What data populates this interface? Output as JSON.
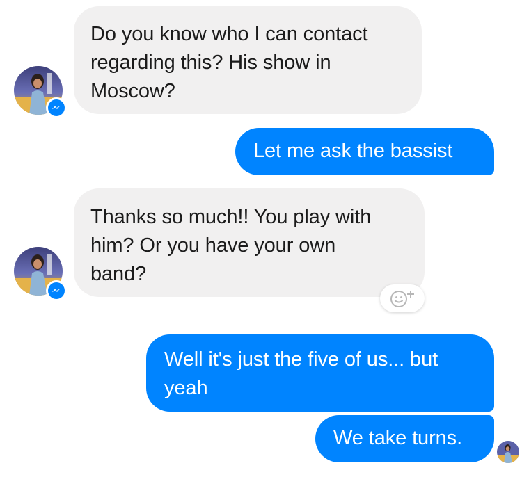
{
  "conversation": {
    "messages": [
      {
        "sender": "them",
        "text": "Do you know who I can contact\nregarding this? His show in\nMoscow?"
      },
      {
        "sender": "me",
        "text": "Let me ask the bassist"
      },
      {
        "sender": "them",
        "text": "Thanks so much!! You play with\nhim? Or you have your own\nband?"
      },
      {
        "sender": "me",
        "text": "Well it's just the five of us... but\nyeah"
      },
      {
        "sender": "me",
        "text": "We take turns."
      }
    ]
  },
  "icons": {
    "messenger_badge": "messenger-icon",
    "reaction": "add-reaction-icon"
  },
  "colors": {
    "outgoing_bubble": "#0084ff",
    "incoming_bubble": "#f1f0f0",
    "messenger_blue": "#0084ff"
  }
}
